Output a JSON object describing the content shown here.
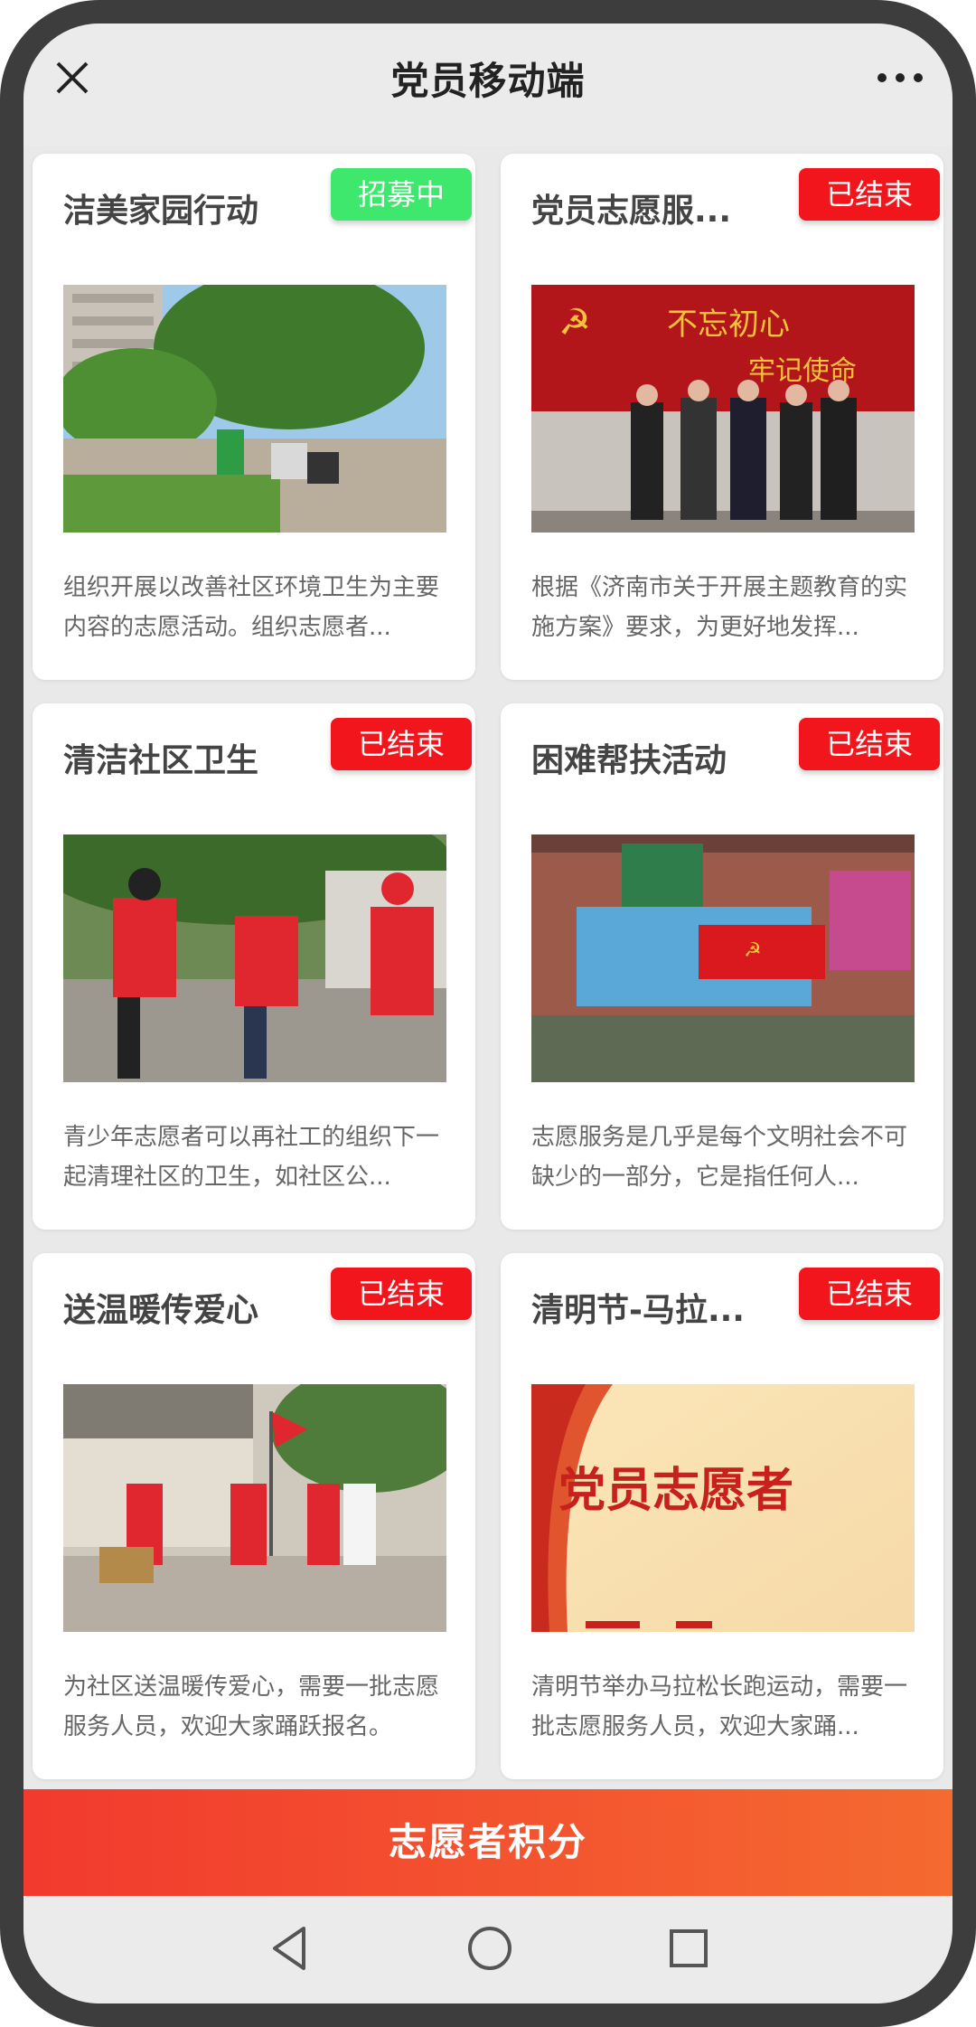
{
  "header": {
    "title": "党员移动端",
    "close_icon": "close-icon",
    "more_icon": "more-icon"
  },
  "colors": {
    "recruiting": "#3ee86c",
    "ended": "#f2151c",
    "bottom_button": "#f23a2e"
  },
  "activities": [
    {
      "title": "洁美家园行动",
      "status": "招募中",
      "description": "组织开展以改善社区环境卫生为主要内容的志愿活动。组织志愿者..."
    },
    {
      "title": "党员志愿服...",
      "status": "已结束",
      "description": "根据《济南市关于开展主题教育的实施方案》要求，为更好地发挥..."
    },
    {
      "title": "清洁社区卫生",
      "status": "已结束",
      "description": "青少年志愿者可以再社工的组织下一起清理社区的卫生，如社区公..."
    },
    {
      "title": "困难帮扶活动",
      "status": "已结束",
      "description": "志愿服务是几乎是每个文明社会不可缺少的一部分，它是指任何人..."
    },
    {
      "title": "送温暖传爱心",
      "status": "已结束",
      "description": "为社区送温暖传爱心，需要一批志愿服务人员，欢迎大家踊跃报名。"
    },
    {
      "title": "清明节-马拉...",
      "status": "已结束",
      "description": "清明节举办马拉松长跑运动，需要一批志愿服务人员，欢迎大家踊..."
    }
  ],
  "image_texts": {
    "banner_slogan_1": "不忘初心",
    "banner_slogan_2": "牢记使命",
    "volunteer_poster": "党员志愿者"
  },
  "bottom_button": {
    "label": "志愿者积分"
  },
  "navbar": {
    "back_icon": "back-triangle-icon",
    "home_icon": "home-circle-icon",
    "recent_icon": "recent-square-icon"
  }
}
